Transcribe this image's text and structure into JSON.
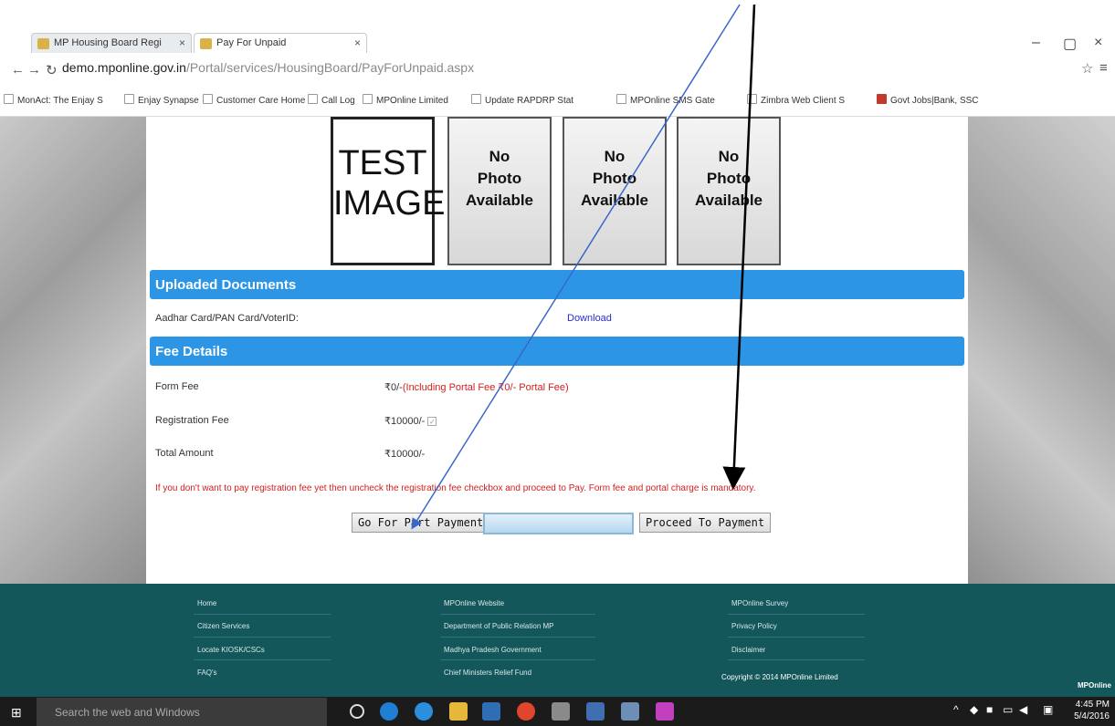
{
  "browser": {
    "tabs": [
      {
        "label": "MP Housing Board Regi"
      },
      {
        "label": "Pay For Unpaid"
      }
    ],
    "url_host": "demo.mponline.gov.in",
    "url_path": "/Portal/services/HousingBoard/PayForUnpaid.aspx",
    "bookmarks": [
      "MonAct: The Enjay S",
      "Enjay Synapse",
      "Customer Care Home",
      "Call Log",
      "MPOnline Limited",
      "Update RAPDRP Stat",
      "MPOnline SMS Gate",
      "Zimbra Web Client S",
      "Govt Jobs|Bank, SSC"
    ]
  },
  "photos": {
    "test_line1": "TEST",
    "test_line2": "IMAGE",
    "no_photo": [
      "No",
      "Photo",
      "Available"
    ]
  },
  "uploaded": {
    "title": "Uploaded Documents",
    "doc_label": "Aadhar Card/PAN Card/VoterID:",
    "download_label": "Download"
  },
  "fees": {
    "title": "Fee Details",
    "form_fee_label": "Form Fee",
    "form_fee_value": "₹0/-",
    "form_fee_note": "(Including Portal Fee ₹0/-  Portal Fee)",
    "registration_fee_label": "Registration Fee",
    "registration_fee_value": "₹10000/-",
    "total_label": "Total Amount",
    "total_value": "₹10000/-",
    "notice": "If you don't want to pay registration fee yet then uncheck the registration fee checkbox and proceed to Pay. Form fee and portal charge is mandatory."
  },
  "buttons": {
    "part_payment": "Go For Part Payment",
    "proceed": "Proceed To Payment"
  },
  "footer": {
    "col1": [
      "Home",
      "Citizen Services",
      "Locate KIOSK/CSCs",
      "FAQ's"
    ],
    "col2": [
      "MPOnline Website",
      "Department of Public Relation MP",
      "Madhya Pradesh Government",
      "Chief Ministers Relief Fund"
    ],
    "col3": [
      "MPOnline Survey",
      "Privacy Policy",
      "Disclaimer"
    ],
    "copyright": "Copyright © 2014 MPOnline Limited",
    "brand": "MPOnline"
  },
  "taskbar": {
    "search_placeholder": "Search the web and Windows",
    "time": "4:45 PM",
    "date": "5/4/2016"
  }
}
